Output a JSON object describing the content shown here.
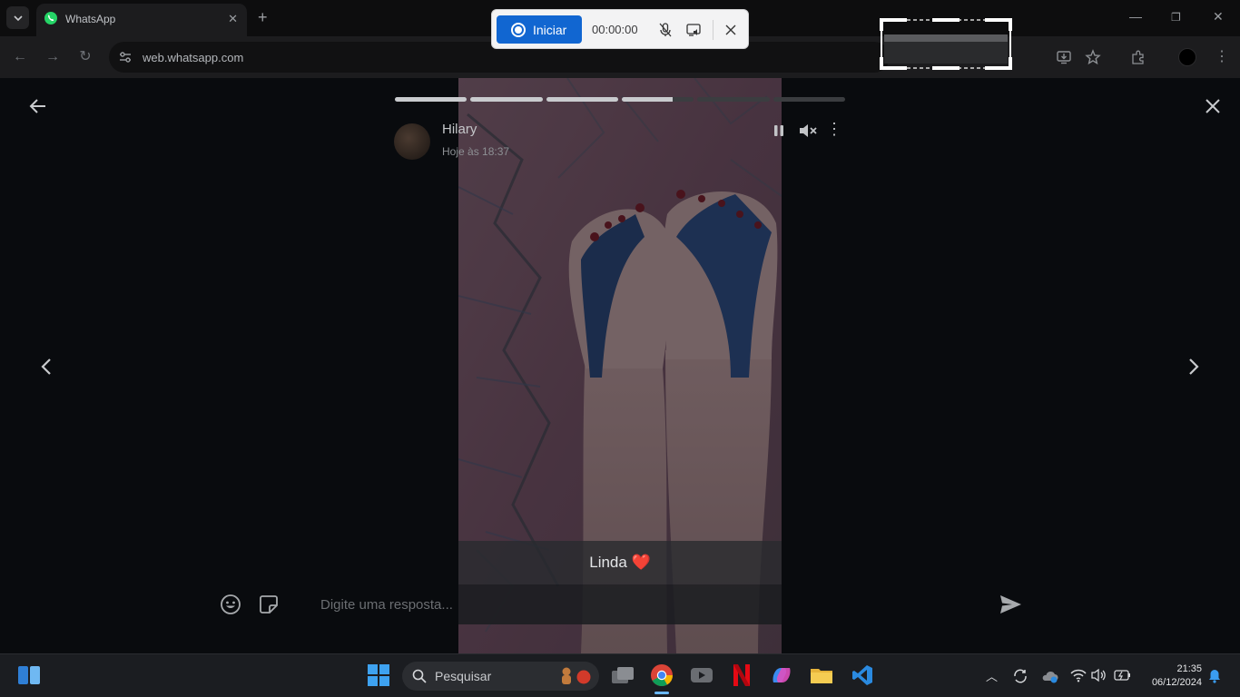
{
  "browser": {
    "tab_title": "WhatsApp",
    "url": "web.whatsapp.com"
  },
  "recorder": {
    "start_label": "Iniciar",
    "timer": "00:00:00"
  },
  "status": {
    "sender": "Hilary",
    "timestamp": "Hoje às 18:37",
    "caption": "Linda ❤️",
    "reply_placeholder": "Digite uma resposta...",
    "segments_total": 6,
    "segments_done": 3,
    "current_segment_progress": 0.7
  },
  "taskbar": {
    "search_label": "Pesquisar",
    "time": "21:35",
    "date": "06/12/2024"
  },
  "colors": {
    "accent": "#1166d1",
    "whatsapp_green": "#25d366"
  }
}
